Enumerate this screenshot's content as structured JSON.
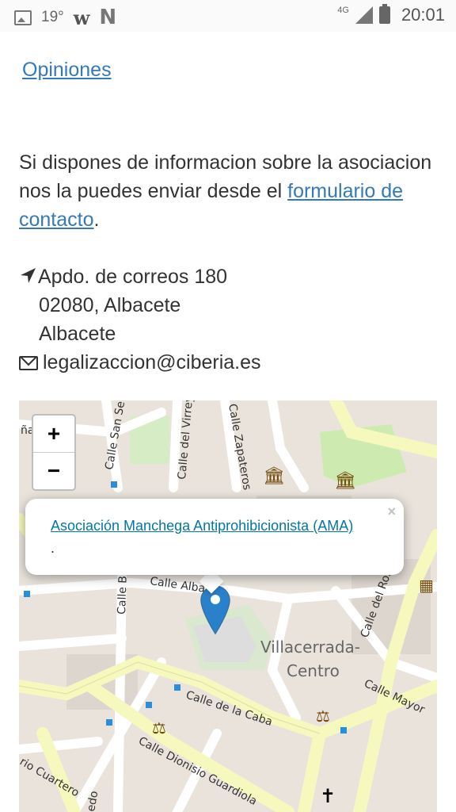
{
  "status_bar": {
    "temperature": "19°",
    "app_icons": [
      "image-icon",
      "wattpad-icon",
      "netflix-icon"
    ],
    "network": "4G",
    "time": "20:01"
  },
  "content": {
    "opiniones_link": "Opiniones",
    "info_text": "Si dispones de informacion sobre la asociacion nos la puedes enviar desde el ",
    "contact_link": "formulario de contacto",
    "info_end": ".",
    "address": {
      "line1": "Apdo. de correos 180",
      "line2": "02080, Albacete",
      "line3": "Albacete"
    },
    "email": "legalizaccion@ciberia.es"
  },
  "map": {
    "zoom_in": "+",
    "zoom_out": "−",
    "popup_title": "Asociación Manchega Antiprohibicionista (AMA)",
    "popup_sub": ".",
    "popup_close": "×",
    "labels": {
      "calle_san": "Calle San Se",
      "calle_virrey": "Calle del Virrey",
      "calle_zapateros": "Calle Zapateros",
      "calle_alba": "Calle Alba",
      "calle_b": "Calle B",
      "calle_rosario": "Calle del Ros",
      "district_1": "Villacerrada-",
      "district_2": "Centro",
      "calle_mayor": "Calle Mayor",
      "calle_caba": "Calle de la Caba",
      "calle_dionisio": "Calle Dionisio Guardiola",
      "calle_cuartero": "rio Cuartero",
      "edo": "edo",
      "partial": "ña"
    }
  },
  "colors": {
    "link": "#337ab7",
    "popup_link": "#0078A8",
    "marker": "#2a81cb"
  }
}
